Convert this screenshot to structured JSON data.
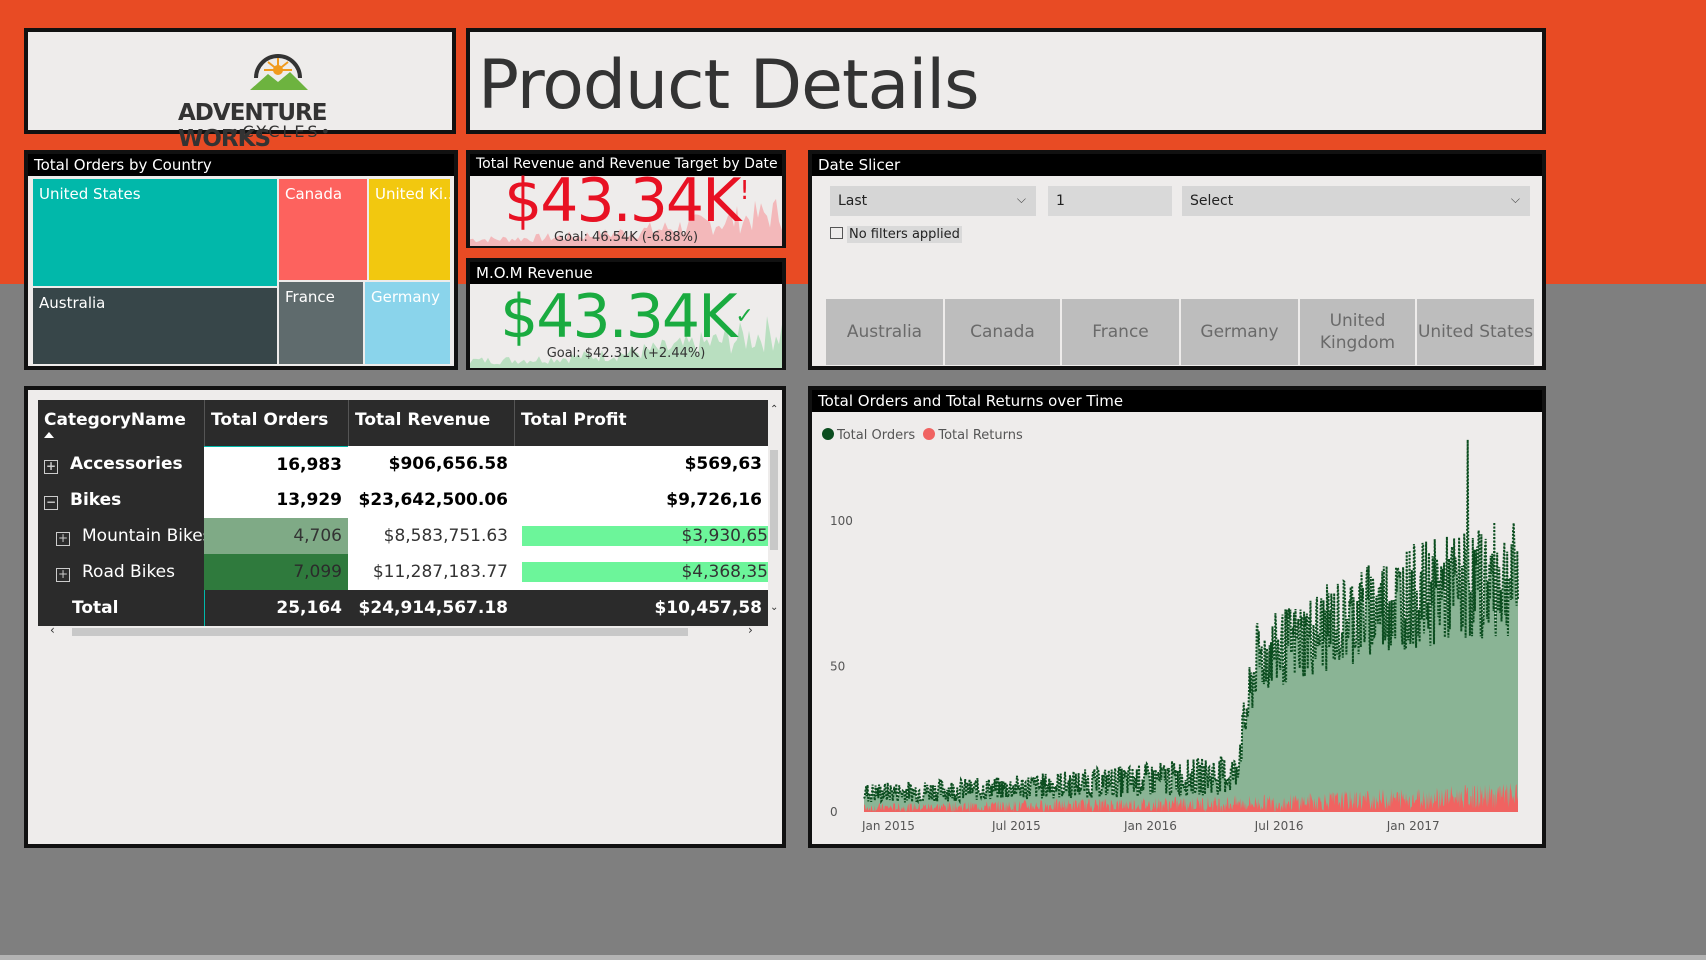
{
  "header": {
    "logo_title": "ADVENTURE WORKS",
    "logo_subtitle": "CYCLES",
    "page_title": "Product Details"
  },
  "treemap": {
    "title": "Total Orders by Country",
    "cells": [
      {
        "label": "United States",
        "color": "#01b8aa"
      },
      {
        "label": "Australia",
        "color": "#374649"
      },
      {
        "label": "Canada",
        "color": "#fd625e"
      },
      {
        "label": "France",
        "color": "#5f6b6d"
      },
      {
        "label": "United Ki...",
        "color": "#f2c80f"
      },
      {
        "label": "Germany",
        "color": "#8ad4eb"
      }
    ]
  },
  "kpi_revenue": {
    "title": "Total Revenue and Revenue Target by Date",
    "value": "$43.34K",
    "indicator": "!",
    "goal": "Goal: 46.54K (-6.88%)",
    "color": "#e81123"
  },
  "kpi_mom": {
    "title": "M.O.M Revenue",
    "value": "$43.34K",
    "indicator": "✓",
    "goal": "Goal: $42.31K (+2.44%)",
    "color": "#1aab40"
  },
  "date_slicer": {
    "title": "Date Slicer",
    "mode": "Last",
    "count": "1",
    "period": "Select",
    "status": "No filters applied",
    "countries": [
      "Australia",
      "Canada",
      "France",
      "Germany",
      "United Kingdom",
      "United States"
    ]
  },
  "matrix": {
    "columns": [
      "CategoryName",
      "Total Orders",
      "Total Revenue",
      "Total Profit"
    ],
    "rows": [
      {
        "name": "Accessories",
        "orders": "16,983",
        "revenue": "$906,656.58",
        "profit": "$569,63",
        "expander": "+"
      },
      {
        "name": "Bikes",
        "orders": "13,929",
        "revenue": "$23,642,500.06",
        "profit": "$9,726,16",
        "expander": "−"
      },
      {
        "name": "Mountain Bikes",
        "orders": "4,706",
        "revenue": "$8,583,751.63",
        "profit": "$3,930,65",
        "expander": "+"
      },
      {
        "name": "Road Bikes",
        "orders": "7,099",
        "revenue": "$11,287,183.77",
        "profit": "$4,368,35",
        "expander": "+"
      }
    ],
    "total": {
      "name": "Total",
      "orders": "25,164",
      "revenue": "$24,914,567.18",
      "profit": "$10,457,58"
    }
  },
  "chart_data": {
    "type": "area",
    "title": "Total Orders and Total Returns over Time",
    "series": [
      {
        "name": "Total Orders",
        "color": "#0b4d1f"
      },
      {
        "name": "Total Returns",
        "color": "#f06361"
      }
    ],
    "y_ticks": [
      "0",
      "50",
      "100"
    ],
    "ylim": [
      0,
      130
    ],
    "x_ticks": [
      "Jan 2015",
      "Jul 2015",
      "Jan 2016",
      "Jul 2016",
      "Jan 2017"
    ],
    "legend_position": "top-left",
    "orders_profile": [
      {
        "x": "Jan 2015",
        "low": 3,
        "high": 10
      },
      {
        "x": "Jul 2015",
        "low": 4,
        "high": 12
      },
      {
        "x": "Jan 2016",
        "low": 5,
        "high": 16
      },
      {
        "x": "Jun 2016",
        "low": 6,
        "high": 20
      },
      {
        "x": "Jul 2016",
        "low": 40,
        "high": 65
      },
      {
        "x": "Jan 2017",
        "low": 55,
        "high": 90
      },
      {
        "x": "Jun 2017",
        "low": 60,
        "high": 100
      }
    ],
    "orders_peak": {
      "x": "Apr 2017",
      "y": 128
    },
    "returns_profile": [
      {
        "x": "Jan 2015",
        "low": 0,
        "high": 3
      },
      {
        "x": "Jul 2016",
        "low": 0,
        "high": 6
      },
      {
        "x": "Jun 2017",
        "low": 1,
        "high": 10
      }
    ]
  }
}
